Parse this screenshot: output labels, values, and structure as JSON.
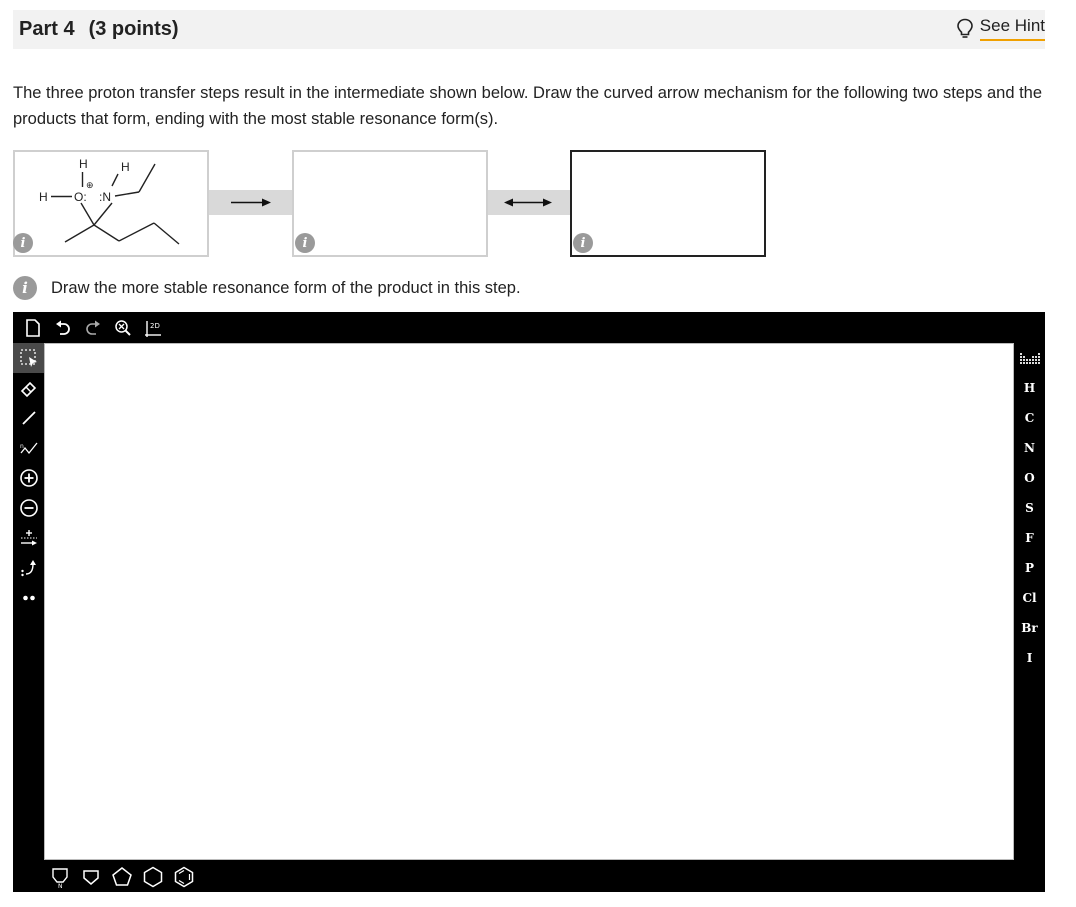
{
  "header": {
    "part": "Part 4",
    "points": "(3 points)",
    "hint_label": "See Hint"
  },
  "prompt": "The three proton transfer steps result in the intermediate shown below. Draw the curved arrow mechanism for the following two steps and the products that form, ending with the most stable resonance form(s).",
  "mechanism": {
    "box1_atoms": {
      "h_top_o": "H",
      "h_top_n": "H",
      "h_left": "H",
      "oxygen": "O:",
      "charge": "⊕",
      "nitrogen": ":N"
    },
    "info_icon": "i"
  },
  "instruction": "Draw the more stable resonance form of the product in this step.",
  "editor": {
    "top_tools": [
      "new-document",
      "undo",
      "redo",
      "zoom",
      "clean-2d"
    ],
    "left_tools": [
      "select",
      "eraser",
      "single-bond",
      "chain",
      "positive-charge",
      "negative-charge",
      "reaction-arrow",
      "curved-arrow",
      "lone-pair"
    ],
    "periodic_table_icon": "periodic-table",
    "atoms": [
      "H",
      "C",
      "N",
      "O",
      "S",
      "F",
      "P",
      "Cl",
      "Br",
      "I"
    ],
    "bottom_templates": [
      "pyridine-template",
      "cyclopropane-template",
      "cyclopentane-template",
      "cyclohexane-template",
      "benzene-template"
    ]
  }
}
